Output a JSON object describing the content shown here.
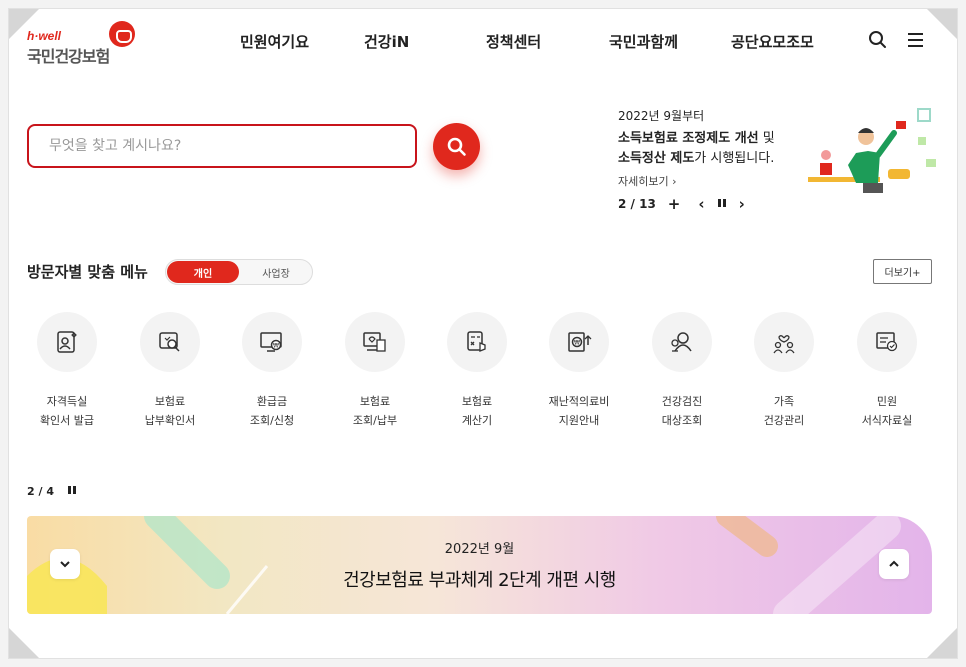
{
  "header": {
    "logo_sub": "h·well",
    "logo_main": "국민건강보험",
    "nav": [
      "민원여기요",
      "건강iN",
      "정책센터",
      "국민과함께",
      "공단요모조모"
    ]
  },
  "search": {
    "placeholder": "무엇을 찾고 계시나요?"
  },
  "banner": {
    "date": "2022년 9월부터",
    "line1_bold": "소득보험료 조정제도 개선",
    "line1_rest": " 및",
    "line2_bold": "소득정산 제도",
    "line2_rest": "가 시행됩니다.",
    "more": "자세히보기 ›",
    "pager": "2 / 13",
    "plus": "+",
    "prev": "‹",
    "next": "›"
  },
  "visitor_menu": {
    "title": "방문자별 맞춤 메뉴",
    "tab_personal": "개인",
    "tab_business": "사업장",
    "more_button": "더보기+",
    "items": [
      {
        "line1": "자격득실",
        "line2": "확인서 발급",
        "icon": "certificate-icon"
      },
      {
        "line1": "보험료",
        "line2": "납부확인서",
        "icon": "payment-confirm-icon"
      },
      {
        "line1": "환급금",
        "line2": "조회/신청",
        "icon": "refund-icon"
      },
      {
        "line1": "보험료",
        "line2": "조회/납부",
        "icon": "premium-inquiry-icon"
      },
      {
        "line1": "보험료",
        "line2": "계산기",
        "icon": "calculator-icon"
      },
      {
        "line1": "재난적의료비",
        "line2": "지원안내",
        "icon": "medical-support-icon"
      },
      {
        "line1": "건강검진",
        "line2": "대상조회",
        "icon": "checkup-icon"
      },
      {
        "line1": "가족",
        "line2": "건강관리",
        "icon": "family-icon"
      },
      {
        "line1": "민원",
        "line2": "서식자료실",
        "icon": "forms-icon"
      }
    ],
    "pager": "2 / 4"
  },
  "bottom_banner": {
    "date": "2022년 9월",
    "title": "건강보험료 부과체계 2단계 개편 시행"
  },
  "colors": {
    "brand_red": "#e0281d",
    "search_border": "#c8141b"
  }
}
